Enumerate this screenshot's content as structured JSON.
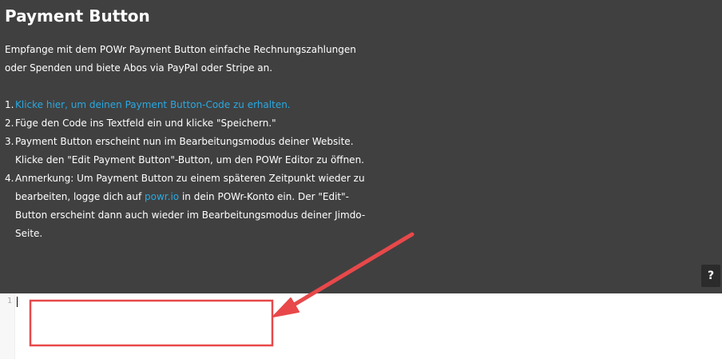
{
  "panel": {
    "title": "Payment Button",
    "intro_lines": [
      "Empfange mit dem POWr Payment Button einfache Rechnungszahlungen",
      "oder Spenden und biete Abos via PayPal oder Stripe an."
    ],
    "steps": [
      {
        "number": "1.",
        "link_text": "Klicke hier, um deinen Payment Button-Code zu erhalten."
      },
      {
        "number": "2.",
        "text": "Füge den Code ins Textfeld ein und klicke \"Speichern.\""
      },
      {
        "number": "3.",
        "line1": "Payment Button erscheint nun im Bearbeitungsmodus deiner Website.",
        "line2": "Klicke den \"Edit Payment Button\"-Button, um den POWr Editor zu öffnen."
      },
      {
        "number": "4.",
        "line1": "Anmerkung: Um Payment Button zu einem späteren Zeitpunkt wieder zu",
        "line2_before": "bearbeiten, logge dich auf ",
        "line2_link": "powr.io",
        "line2_after": " in dein POWr-Konto ein. Der \"Edit\"-",
        "line3": "Button erscheint dann auch wieder im Bearbeitungsmodus deiner Jimdo-",
        "line4": "Seite."
      }
    ],
    "help_label": "?"
  },
  "editor": {
    "line_number": "1"
  },
  "colors": {
    "panel_bg": "#404040",
    "link": "#29a9e1",
    "annotation": "#e8484a"
  }
}
